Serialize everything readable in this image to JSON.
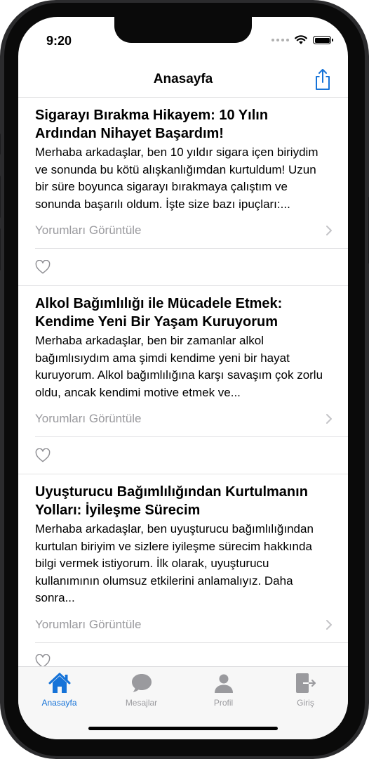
{
  "status": {
    "time": "9:20"
  },
  "nav": {
    "title": "Anasayfa"
  },
  "colors": {
    "accent": "#1673d8",
    "muted": "#9a9a9e"
  },
  "posts": [
    {
      "title": "Sigarayı Bırakma Hikayem: 10 Yılın Ardından Nihayet Başardım!",
      "body": "Merhaba arkadaşlar, ben 10 yıldır sigara içen biriydim ve sonunda bu kötü alışkanlığımdan kurtuldum! Uzun bir süre boyunca sigarayı bırakmaya çalıştım ve sonunda başarılı oldum. İşte size bazı ipuçları:...",
      "comments_label": "Yorumları Görüntüle"
    },
    {
      "title": "Alkol Bağımlılığı ile Mücadele Etmek: Kendime Yeni Bir Yaşam Kuruyorum",
      "body": "Merhaba arkadaşlar, ben bir zamanlar alkol bağımlısıydım ama şimdi kendime yeni bir hayat kuruyorum. Alkol bağımlılığına karşı savaşım çok zorlu oldu, ancak kendimi motive etmek ve...",
      "comments_label": "Yorumları Görüntüle"
    },
    {
      "title": "Uyuşturucu Bağımlılığından Kurtulmanın Yolları: İyileşme Sürecim",
      "body": "Merhaba arkadaşlar, ben uyuşturucu bağımlılığından kurtulan biriyim ve sizlere iyileşme sürecim hakkında bilgi vermek istiyorum. İlk olarak, uyuşturucu kullanımının olumsuz etkilerini anlamalıyız. Daha sonra...",
      "comments_label": "Yorumları Görüntüle"
    }
  ],
  "tabs": [
    {
      "label": "Anasayfa",
      "icon": "house-icon",
      "active": true
    },
    {
      "label": "Mesajlar",
      "icon": "chat-bubble-icon",
      "active": false
    },
    {
      "label": "Profil",
      "icon": "person-icon",
      "active": false
    },
    {
      "label": "Giriş",
      "icon": "login-icon",
      "active": false
    }
  ]
}
